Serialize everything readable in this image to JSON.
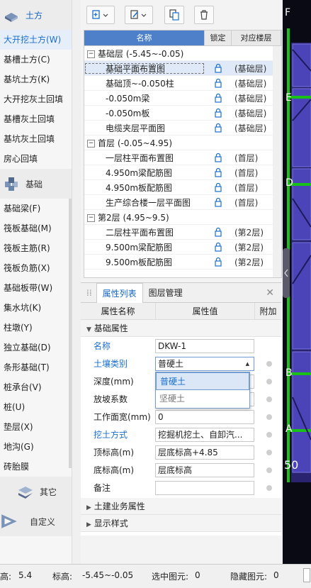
{
  "sidebar": {
    "categories": [
      {
        "label": "土方",
        "icon": "earthwork-icon"
      },
      {
        "label": "基础",
        "icon": "foundation-icon"
      },
      {
        "label": "其它",
        "icon": "other-icon"
      },
      {
        "label": "自定义",
        "icon": "custom-icon"
      }
    ],
    "earthwork_items": [
      "大开挖土方(W)",
      "基槽土方(C)",
      "基坑土方(K)",
      "大开挖灰土回填",
      "基槽灰土回填",
      "基坑灰土回填",
      "房心回填"
    ],
    "foundation_items": [
      "基础梁(F)",
      "筏板基础(M)",
      "筏板主筋(R)",
      "筏板负筋(X)",
      "基础板带(W)",
      "集水坑(K)",
      "柱墩(Y)",
      "独立基础(D)",
      "条形基础(T)",
      "桩承台(V)",
      "桩(U)",
      "垫层(X)",
      "地沟(G)",
      "砖胎膜"
    ]
  },
  "tree": {
    "headers": {
      "name": "名称",
      "lock": "锁定",
      "floor": "对应楼层"
    },
    "rows": [
      {
        "type": "group",
        "name": "基础层 (-5.45~-0.05)"
      },
      {
        "type": "item",
        "name": "基础平面布置图",
        "floor": "(基础层)",
        "selected": true
      },
      {
        "type": "item",
        "name": "基础顶~-0.050柱",
        "floor": "(基础层)"
      },
      {
        "type": "item",
        "name": "-0.050m梁",
        "floor": "(基础层)"
      },
      {
        "type": "item",
        "name": "-0.050m板",
        "floor": "(基础层)"
      },
      {
        "type": "item",
        "name": "电缆夹层平面图",
        "floor": "(基础层)"
      },
      {
        "type": "group",
        "name": "首层 (-0.05~4.95)"
      },
      {
        "type": "item",
        "name": "一层柱平面布置图",
        "floor": "(首层)"
      },
      {
        "type": "item",
        "name": "4.950m梁配筋图",
        "floor": "(首层)"
      },
      {
        "type": "item",
        "name": "4.950m板配筋图",
        "floor": "(首层)"
      },
      {
        "type": "item",
        "name": "生产综合楼一层平面图",
        "floor": "(首层)"
      },
      {
        "type": "group",
        "name": "第2层 (4.95~9.5)"
      },
      {
        "type": "item",
        "name": "二层柱平面布置图",
        "floor": "(第2层)"
      },
      {
        "type": "item",
        "name": "9.500m梁配筋图",
        "floor": "(第2层)"
      },
      {
        "type": "item",
        "name": "9.500m板配筋图",
        "floor": "(第2层)"
      }
    ]
  },
  "props": {
    "tabs": [
      "属性列表",
      "图层管理"
    ],
    "headers": {
      "name": "属性名称",
      "value": "属性值",
      "extra": "附加"
    },
    "group_basic": "基础属性",
    "rows": [
      {
        "name": "名称",
        "value": "DKW-1",
        "blue": true,
        "dot": false
      },
      {
        "name": "土壤类别",
        "value": "普硬土",
        "blue": true,
        "dot": true,
        "dropdown": true
      },
      {
        "name": "深度(mm)",
        "value": "",
        "blue": false,
        "dot": true
      },
      {
        "name": "放坡系数",
        "value": "",
        "blue": false,
        "dot": true
      },
      {
        "name": "工作面宽(mm)",
        "value": "0",
        "blue": false,
        "dot": true
      },
      {
        "name": "挖土方式",
        "value": "挖掘机挖土、自卸汽...",
        "blue": true,
        "dot": true
      },
      {
        "name": "顶标高(m)",
        "value": "层底标高+4.85",
        "blue": false,
        "dot": true
      },
      {
        "name": "底标高(m)",
        "value": "层底标高",
        "blue": false,
        "dot": true
      },
      {
        "name": "备注",
        "value": "",
        "blue": false,
        "dot": true
      }
    ],
    "group_business": "土建业务属性",
    "group_display": "显示样式",
    "dropdown_options": [
      "普硬土",
      "坚硬土"
    ]
  },
  "canvas": {
    "axis_labels": [
      "F",
      "E",
      "D",
      "B",
      "A"
    ],
    "scale_text": "50"
  },
  "status": {
    "height_label": "高:",
    "height_value": "5.4",
    "elev_label": "标高:",
    "elev_value": "-5.45~-0.05",
    "selected_label": "选中图元:",
    "selected_value": "0",
    "hidden_label": "隐藏图元:",
    "hidden_value": "0"
  },
  "colors": {
    "accent": "#1a6fd0",
    "header_blue": "#4d80c9",
    "canvas_bg": "#0a0a14",
    "grid_green": "#18c018",
    "slab_blue": "#4a44b8"
  }
}
